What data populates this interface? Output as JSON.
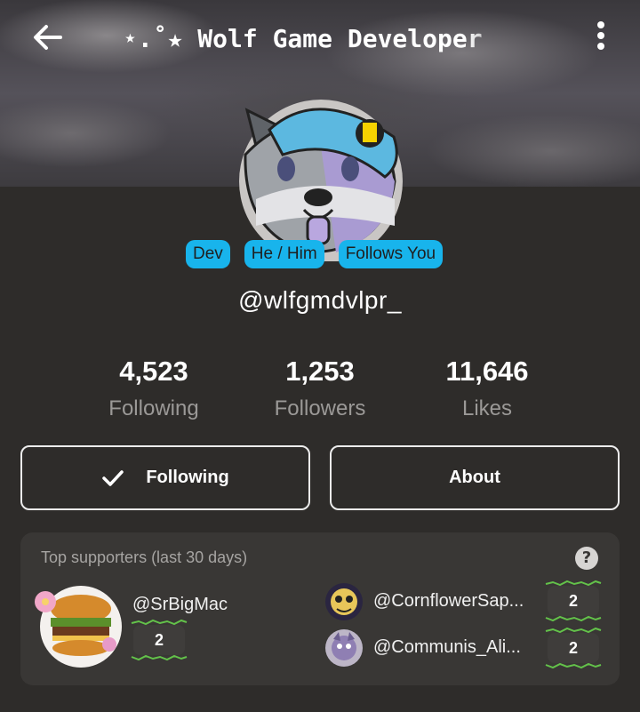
{
  "header": {
    "title": "⋆.˚★ Wolf Game Developer"
  },
  "profile": {
    "badges": [
      "Dev",
      "He / Him",
      "Follows You"
    ],
    "handle": "@wlfgmdvlpr_"
  },
  "stats": [
    {
      "value": "4,523",
      "label": "Following"
    },
    {
      "value": "1,253",
      "label": "Followers"
    },
    {
      "value": "11,646",
      "label": "Likes"
    }
  ],
  "actions": {
    "following_label": "Following",
    "about_label": "About"
  },
  "supporters": {
    "title": "Top supporters (last 30 days)",
    "help_icon": "?",
    "items": [
      {
        "name": "@SrBigMac",
        "count": "2"
      },
      {
        "name": "@CornflowerSap...",
        "count": "2"
      },
      {
        "name": "@Communis_Ali...",
        "count": "2"
      }
    ]
  },
  "colors": {
    "accent_badge": "#18b4ec",
    "background": "#2e2c2a",
    "card": "#393735"
  },
  "icons": {
    "back": "arrow-left-icon",
    "more": "more-vertical-icon",
    "check": "checkmark-icon",
    "help": "question-circle-icon"
  }
}
